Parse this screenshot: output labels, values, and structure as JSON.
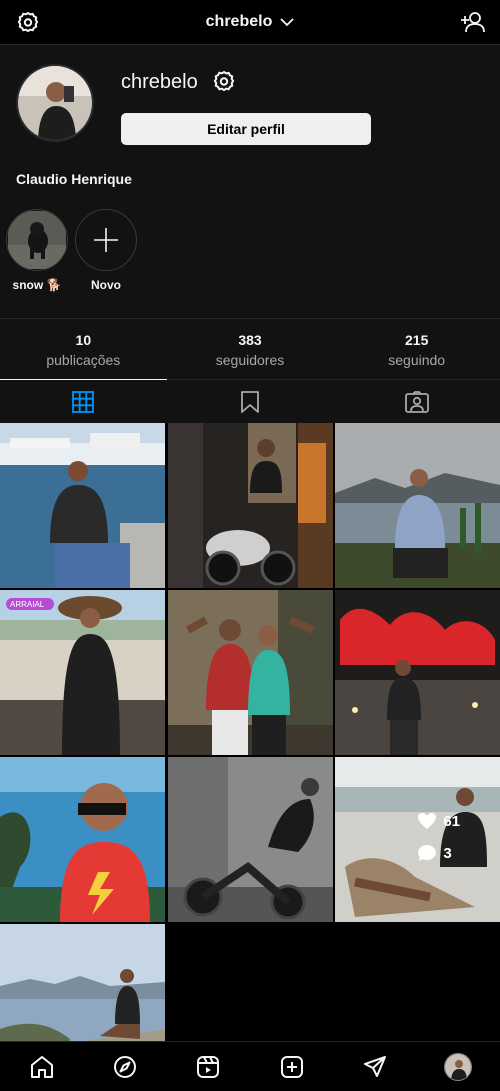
{
  "header": {
    "username_title": "chrebelo",
    "left_icon": "settings-gear-icon",
    "right_icon": "add-user-icon"
  },
  "profile": {
    "username": "chrebelo",
    "edit_label": "Editar perfil",
    "full_name": "Claudio Henrique",
    "highlights": [
      {
        "label": "snow 🐕",
        "kind": "image"
      },
      {
        "label": "Novo",
        "kind": "new"
      }
    ]
  },
  "stats": [
    {
      "value": "10",
      "label": "publicações"
    },
    {
      "value": "383",
      "label": "seguidores"
    },
    {
      "value": "215",
      "label": "seguindo"
    }
  ],
  "tabs": [
    {
      "icon": "grid-icon",
      "active": true
    },
    {
      "icon": "saved-bookmark-icon",
      "active": false
    },
    {
      "icon": "tagged-user-icon",
      "active": false
    }
  ],
  "posts": [
    {
      "id": 1,
      "scene": "marina"
    },
    {
      "id": 2,
      "scene": "motorcycle-night"
    },
    {
      "id": 3,
      "scene": "mountains-sea"
    },
    {
      "id": 4,
      "scene": "beach-hat",
      "sticker": "ARRAIAL"
    },
    {
      "id": 5,
      "scene": "two-men-flex"
    },
    {
      "id": 6,
      "scene": "red-sign-night"
    },
    {
      "id": 7,
      "scene": "selfie-sea"
    },
    {
      "id": 8,
      "scene": "motorcycle-bw"
    },
    {
      "id": 9,
      "scene": "beach-chair",
      "likes": "61",
      "comments": "3"
    },
    {
      "id": 10,
      "scene": "cliff-view"
    }
  ],
  "bottom_nav": [
    "home-icon",
    "explore-compass-icon",
    "reels-icon",
    "new-post-icon",
    "direct-send-icon",
    "profile-avatar"
  ],
  "colors": {
    "background": "#000000",
    "surface": "#121212",
    "accent_blue": "#0095f6",
    "text": "#f5f5f5",
    "muted": "#a8a8a8"
  }
}
